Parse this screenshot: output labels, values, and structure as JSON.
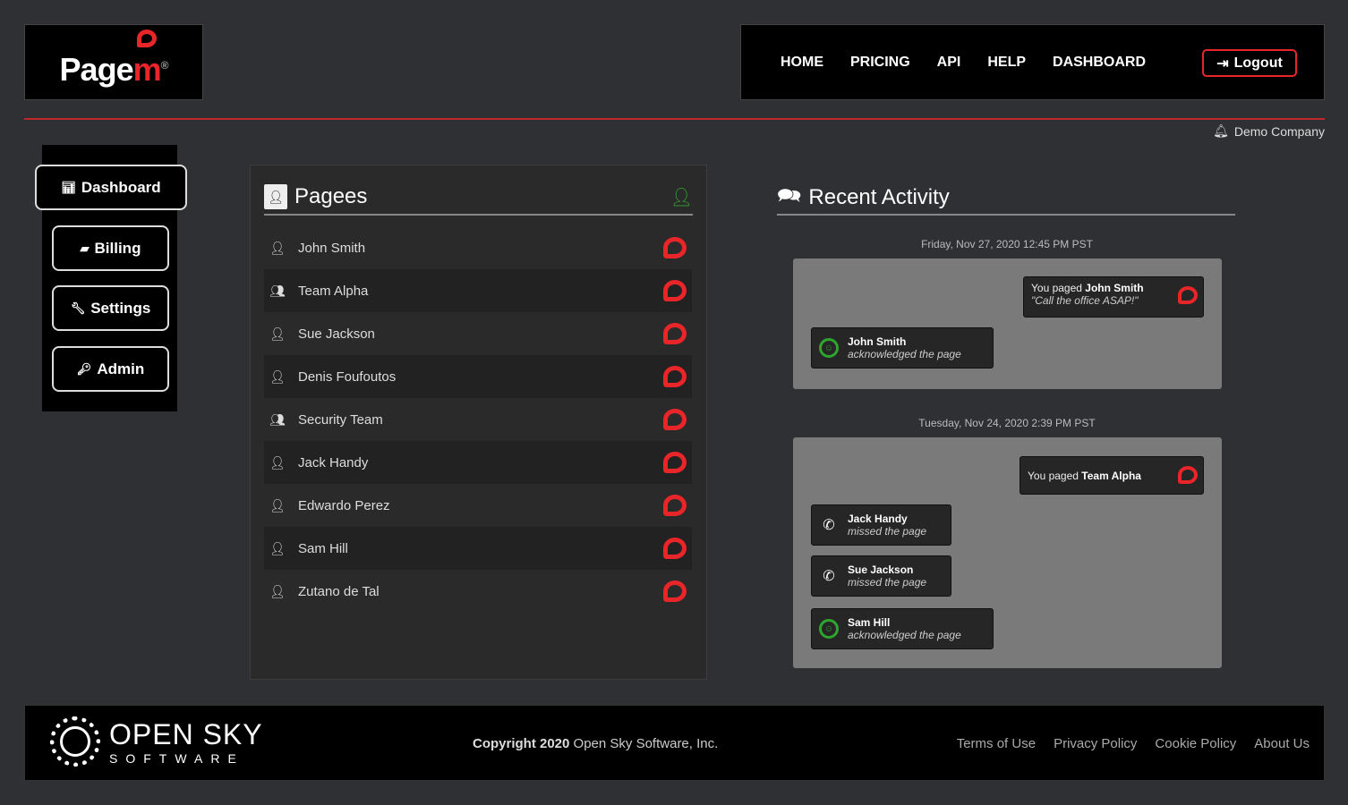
{
  "logo": {
    "text_main": "Page",
    "text_accent": "m",
    "registered": "®"
  },
  "nav": {
    "links": [
      "HOME",
      "PRICING",
      "API",
      "HELP",
      "DASHBOARD"
    ],
    "logout": "Logout"
  },
  "account": {
    "company": "Demo Company"
  },
  "sidebar": {
    "items": [
      {
        "label": "Dashboard",
        "icon": "chart-icon"
      },
      {
        "label": "Billing",
        "icon": "wallet-icon"
      },
      {
        "label": "Settings",
        "icon": "wrench-icon"
      },
      {
        "label": "Admin",
        "icon": "key-icon"
      }
    ]
  },
  "pagees": {
    "title": "Pagees",
    "items": [
      {
        "name": "John Smith",
        "type": "user"
      },
      {
        "name": "Team Alpha",
        "type": "group"
      },
      {
        "name": "Sue Jackson",
        "type": "user"
      },
      {
        "name": "Denis Foufoutos",
        "type": "user"
      },
      {
        "name": "Security Team",
        "type": "group"
      },
      {
        "name": "Jack Handy",
        "type": "user"
      },
      {
        "name": "Edwardo Perez",
        "type": "user"
      },
      {
        "name": "Sam Hill",
        "type": "user"
      },
      {
        "name": "Zutano de Tal",
        "type": "user"
      }
    ]
  },
  "activity": {
    "title": "Recent Activity",
    "groups": [
      {
        "date": "Friday, Nov 27, 2020 12:45 PM PST",
        "paged_prefix": "You paged",
        "paged_target": "John Smith",
        "message": "\"Call the office ASAP!\"",
        "responses": [
          {
            "name": "John Smith",
            "status": "acknowledged the page"
          }
        ]
      },
      {
        "date": "Tuesday, Nov 24, 2020 2:39 PM PST",
        "paged_prefix": "You paged",
        "paged_target": "Team Alpha",
        "responses": [
          {
            "name": "Jack Handy",
            "status": "missed the page"
          },
          {
            "name": "Sue Jackson",
            "status": "missed the page"
          },
          {
            "name": "Sam Hill",
            "status": "acknowledged the page"
          }
        ]
      }
    ]
  },
  "footer": {
    "brand_line1": "OPEN SKY",
    "brand_line2": "SOFTWARE",
    "copyright": "Copyright 2020",
    "company": "Open Sky Software, Inc.",
    "links": [
      "Terms of Use",
      "Privacy Policy",
      "Cookie Policy",
      "About Us"
    ]
  },
  "colors": {
    "accent": "#e8262a",
    "success": "#2ea52e",
    "background": "#2f3034"
  }
}
